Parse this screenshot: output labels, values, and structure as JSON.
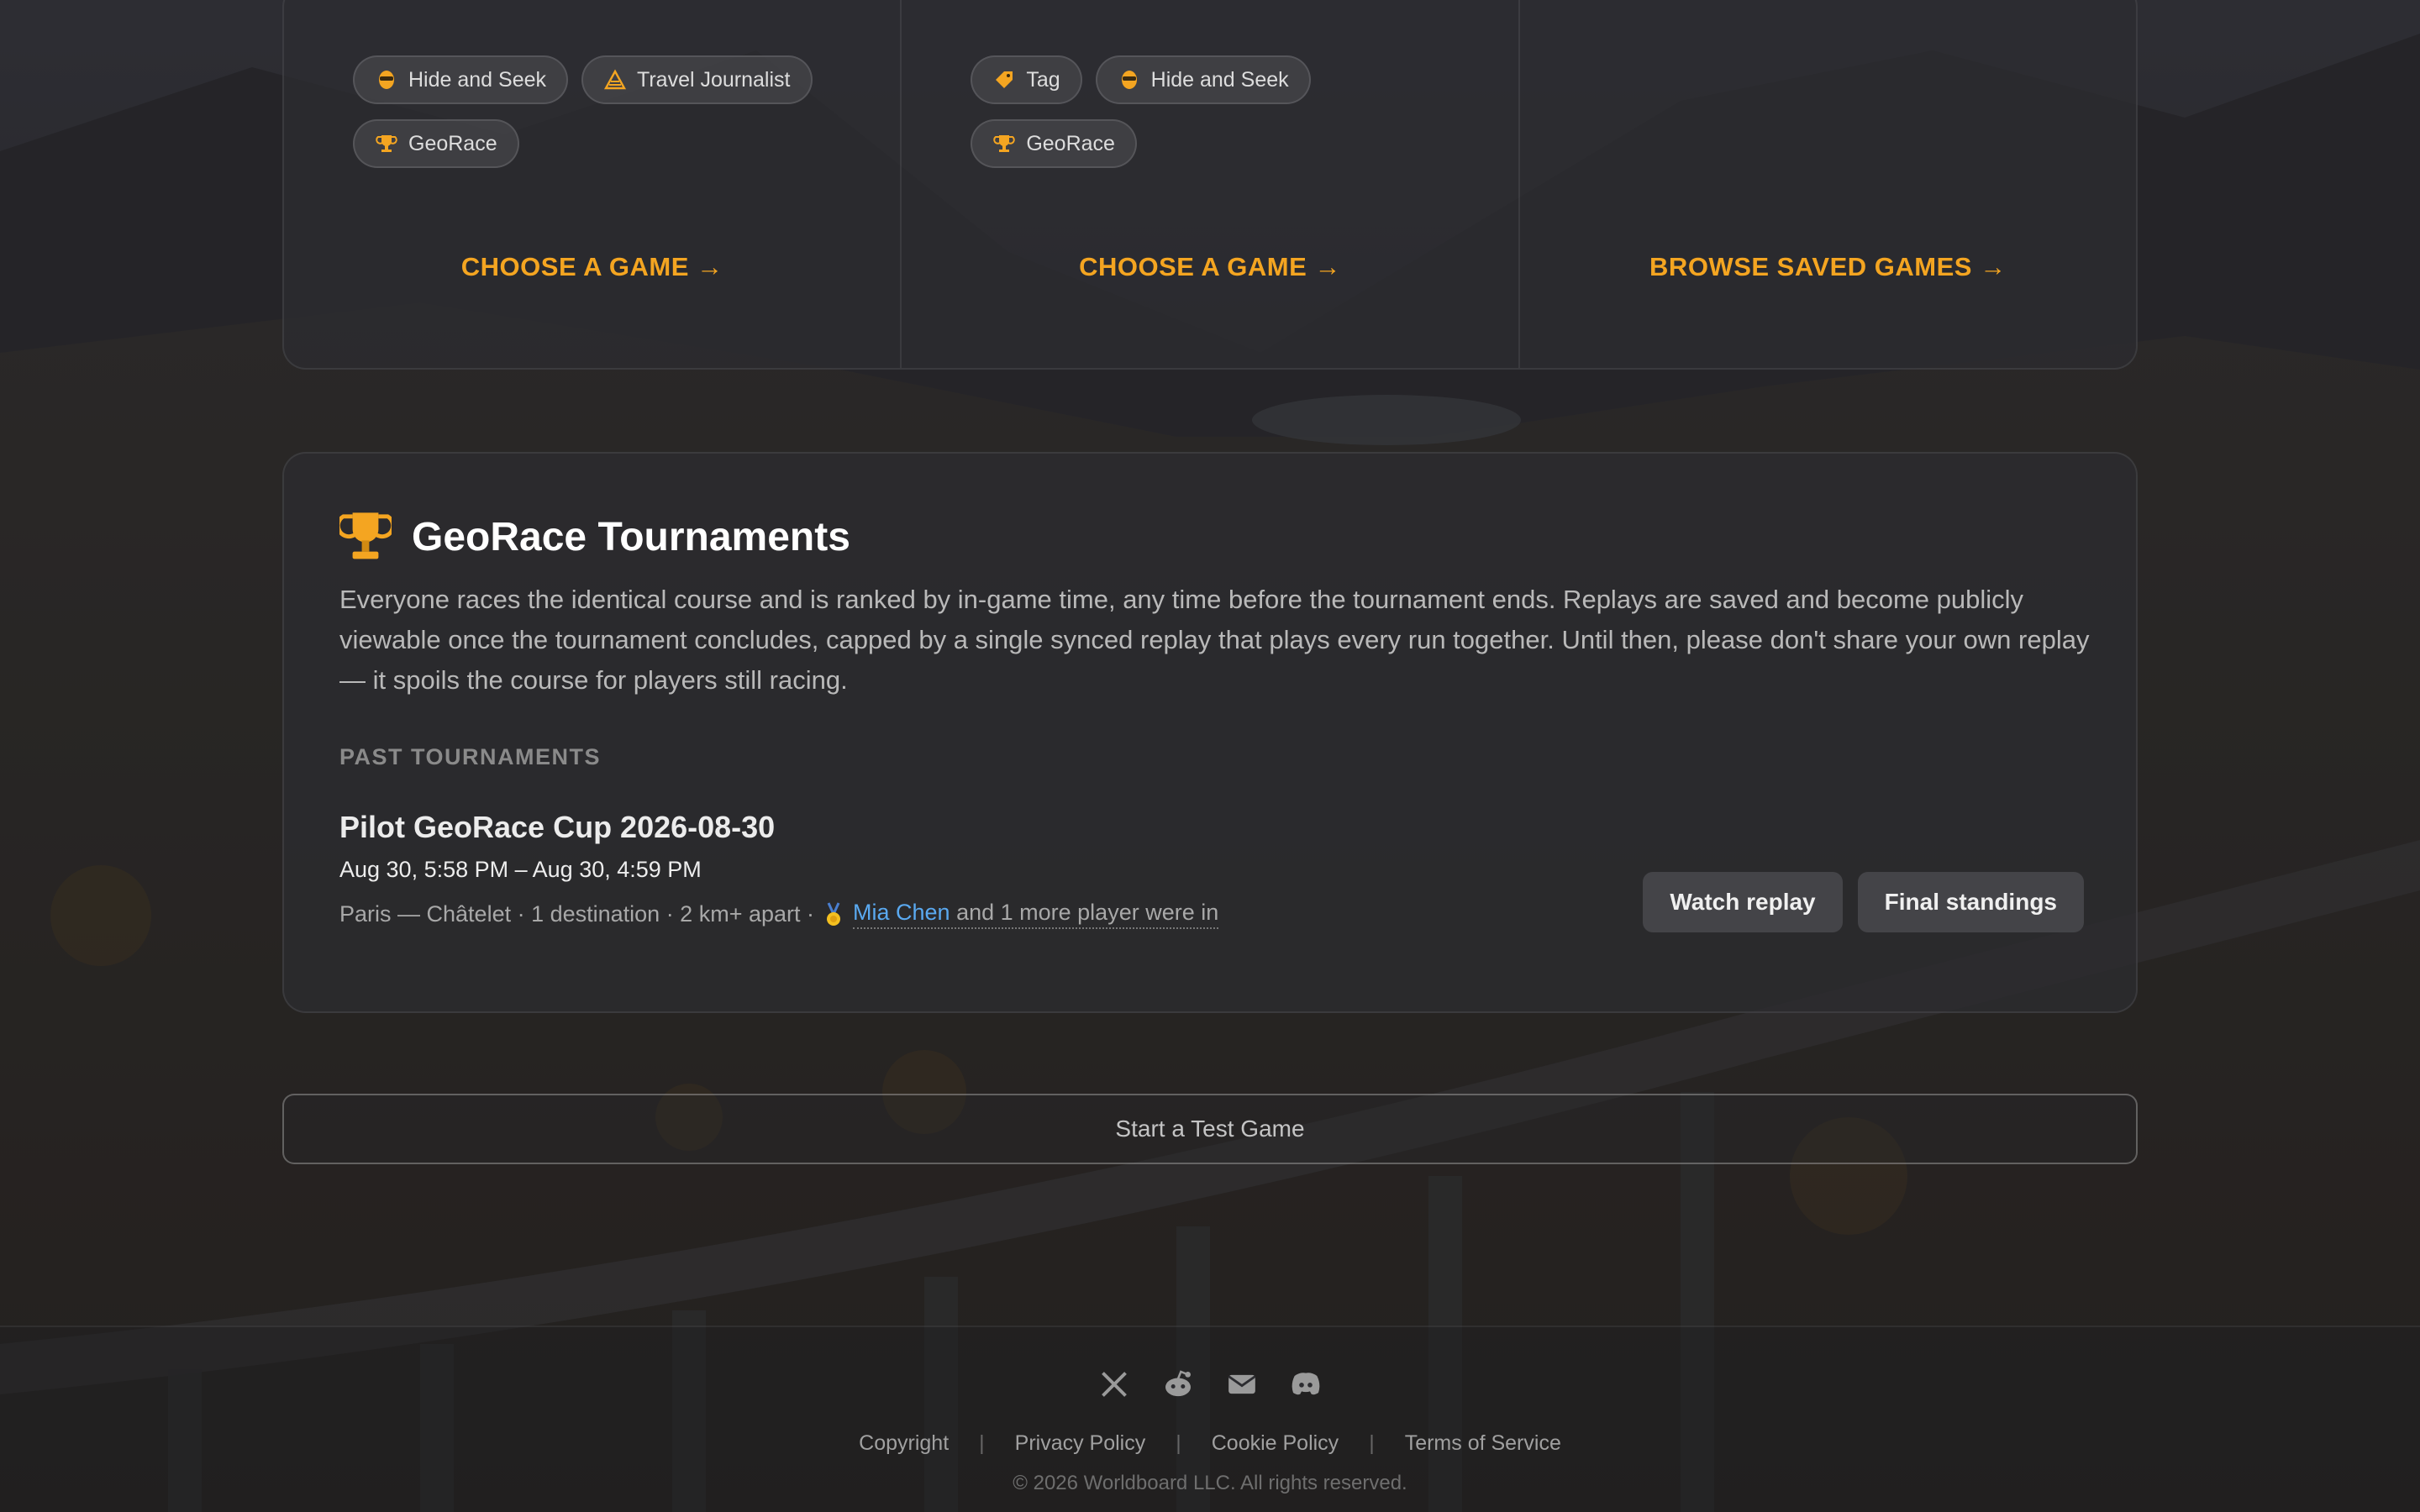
{
  "colors": {
    "accent": "#f4a521",
    "link": "#5aa9f0",
    "panel": "#2c2c30"
  },
  "modes": [
    {
      "chips": [
        {
          "icon": "mask-icon",
          "label": "Hide and Seek"
        },
        {
          "icon": "tent-icon",
          "label": "Travel Journalist"
        },
        {
          "icon": "trophy-icon",
          "label": "GeoRace"
        }
      ],
      "cta": "CHOOSE A GAME →"
    },
    {
      "chips": [
        {
          "icon": "tag-icon",
          "label": "Tag"
        },
        {
          "icon": "mask-icon",
          "label": "Hide and Seek"
        },
        {
          "icon": "trophy-icon",
          "label": "GeoRace"
        }
      ],
      "cta": "CHOOSE A GAME →"
    },
    {
      "chips": [],
      "cta": "BROWSE SAVED GAMES →"
    }
  ],
  "tournaments": {
    "icon": "trophy-icon",
    "title": "GeoRace Tournaments",
    "description": "Everyone races the identical course and is ranked by in-game time, any time before the tournament ends. Replays are saved and become publicly viewable once the tournament concludes, capped by a single synced replay that plays every run together. Until then, please don't share your own replay — it spoils the course for players still racing.",
    "past_label": "PAST TOURNAMENTS",
    "past": [
      {
        "name": "Pilot GeoRace Cup 2026-08-30",
        "dates": "Aug 30, 5:58 PM – Aug 30, 4:59 PM",
        "meta": "Paris — Châtelet · 1 destination · 2 km+ apart ·",
        "medal_icon": "gold-medal-icon",
        "winner": "Mia Chen",
        "more": "and 1 more player were in",
        "watch_label": "Watch replay",
        "standings_label": "Final standings"
      }
    ]
  },
  "test_game_label": "Start a Test Game",
  "footer": {
    "socials": [
      "x-icon",
      "reddit-icon",
      "mail-icon",
      "discord-icon"
    ],
    "links": [
      "Copyright",
      "Privacy Policy",
      "Cookie Policy",
      "Terms of Service"
    ],
    "copyright": "© 2026 Worldboard LLC. All rights reserved."
  }
}
